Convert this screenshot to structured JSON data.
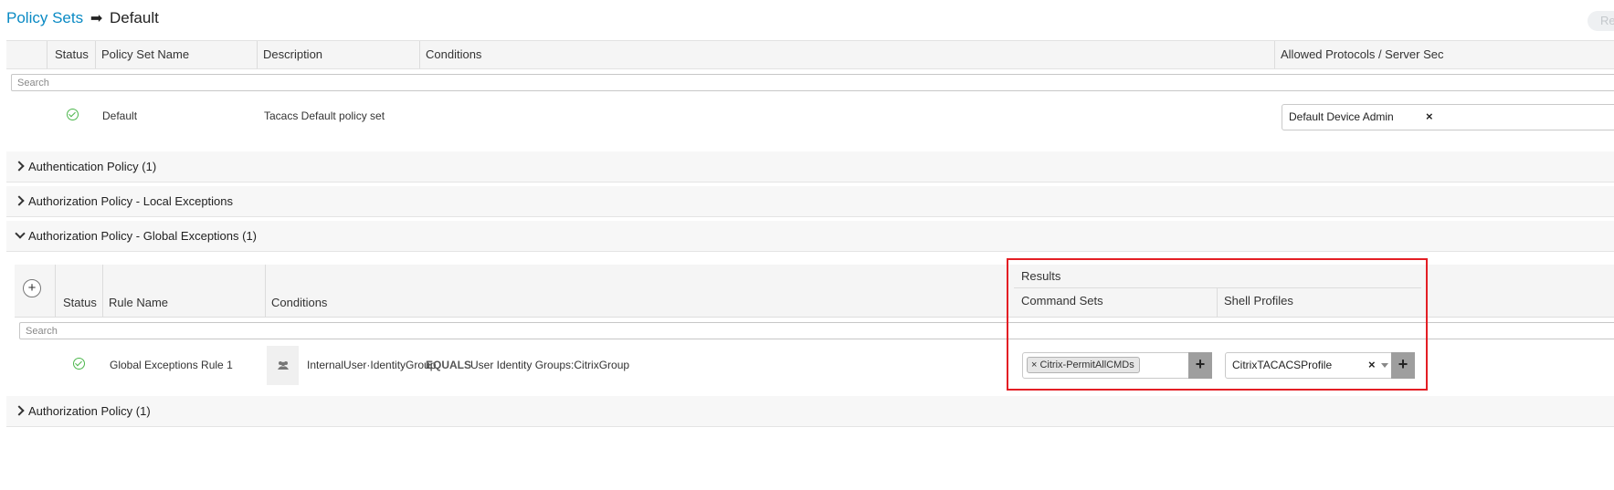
{
  "breadcrumb": {
    "link": "Policy Sets",
    "arrow": "➡",
    "current": "Default"
  },
  "top_button": {
    "label": "Re"
  },
  "policy_table": {
    "headers": {
      "status": "Status",
      "name": "Policy Set Name",
      "description": "Description",
      "conditions": "Conditions",
      "protocols": "Allowed Protocols / Server Sec"
    },
    "search_placeholder": "Search",
    "row": {
      "name": "Default",
      "description": "Tacacs Default policy set",
      "protocol": "Default Device Admin",
      "clear": "×"
    }
  },
  "sections": {
    "authentication": "Authentication Policy (1)",
    "local_exceptions": "Authorization Policy - Local Exceptions",
    "global_exceptions": "Authorization Policy - Global Exceptions (1)",
    "authorization": "Authorization Policy (1)"
  },
  "rules_table": {
    "add": "+",
    "headers": {
      "status": "Status",
      "rule_name": "Rule Name",
      "conditions": "Conditions",
      "results": "Results",
      "command_sets": "Command Sets",
      "shell_profiles": "Shell Profiles"
    },
    "search_placeholder": "Search",
    "row": {
      "rule_name": "Global Exceptions Rule 1",
      "condition_attr": "InternalUser·IdentityGroup",
      "condition_op": "EQUALS",
      "condition_val": "User Identity Groups:CitrixGroup",
      "command_set_chip": "× Citrix-PermitAllCMDs",
      "shell_profile": "CitrixTACACSProfile",
      "clear": "×",
      "add": "+"
    }
  },
  "colors": {
    "link": "#0a8ac4",
    "status_ok": "#4bb64b",
    "highlight": "#e31e24"
  }
}
